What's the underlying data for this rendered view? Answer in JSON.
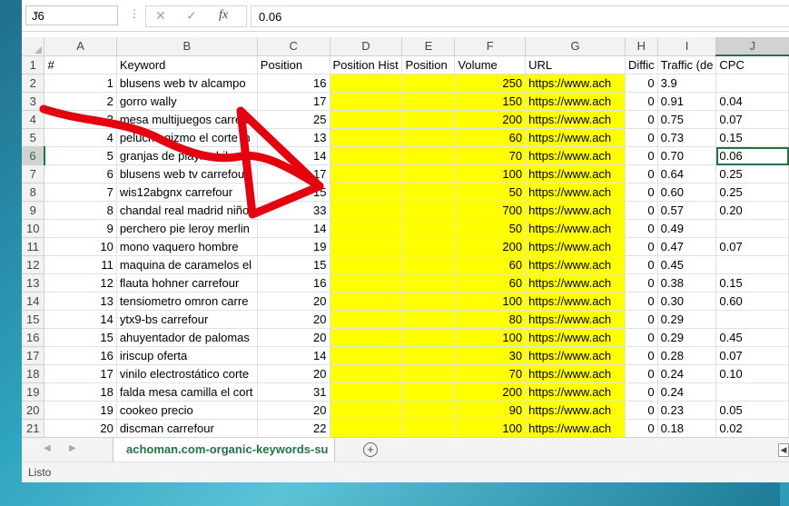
{
  "namebox": {
    "value": "J6"
  },
  "formula": {
    "cancel_icon": "✕",
    "enter_icon": "✓",
    "fx_label": "fx",
    "value": "0.06"
  },
  "columns": [
    "A",
    "B",
    "C",
    "D",
    "E",
    "F",
    "G",
    "H",
    "I",
    "J"
  ],
  "header_row": [
    "#",
    "Keyword",
    "Position",
    "Position Hist",
    "Position",
    "Volume",
    "URL",
    "Diffic",
    "Traffic (de",
    "CPC"
  ],
  "rows": [
    [
      "1",
      "blusens web tv alcampo",
      "16",
      "",
      "",
      "250",
      "https://www.ach",
      "0",
      "3.9",
      ""
    ],
    [
      "2",
      "gorro wally",
      "17",
      "",
      "",
      "150",
      "https://www.ach",
      "0",
      "0.91",
      "0.04"
    ],
    [
      "3",
      "mesa multijuegos carrefo",
      "25",
      "",
      "",
      "200",
      "https://www.ach",
      "0",
      "0.75",
      "0.07"
    ],
    [
      "4",
      "peluche gizmo el corte in",
      "13",
      "",
      "",
      "60",
      "https://www.ach",
      "0",
      "0.73",
      "0.15"
    ],
    [
      "5",
      "granjas de playmobil",
      "14",
      "",
      "",
      "70",
      "https://www.ach",
      "0",
      "0.70",
      "0.06"
    ],
    [
      "6",
      "blusens web tv carrefour",
      "17",
      "",
      "",
      "100",
      "https://www.ach",
      "0",
      "0.64",
      "0.25"
    ],
    [
      "7",
      "wis12abgnx carrefour",
      "15",
      "",
      "",
      "50",
      "https://www.ach",
      "0",
      "0.60",
      "0.25"
    ],
    [
      "8",
      "chandal real madrid niño",
      "33",
      "",
      "",
      "700",
      "https://www.ach",
      "0",
      "0.57",
      "0.20"
    ],
    [
      "9",
      "perchero pie leroy merlin",
      "14",
      "",
      "",
      "50",
      "https://www.ach",
      "0",
      "0.49",
      ""
    ],
    [
      "10",
      "mono vaquero hombre",
      "19",
      "",
      "",
      "200",
      "https://www.ach",
      "0",
      "0.47",
      "0.07"
    ],
    [
      "11",
      "maquina de caramelos el",
      "15",
      "",
      "",
      "60",
      "https://www.ach",
      "0",
      "0.45",
      ""
    ],
    [
      "12",
      "flauta hohner carrefour",
      "16",
      "",
      "",
      "60",
      "https://www.ach",
      "0",
      "0.38",
      "0.15"
    ],
    [
      "13",
      "tensiometro omron carre",
      "20",
      "",
      "",
      "100",
      "https://www.ach",
      "0",
      "0.30",
      "0.60"
    ],
    [
      "14",
      "ytx9-bs carrefour",
      "20",
      "",
      "",
      "80",
      "https://www.ach",
      "0",
      "0.29",
      ""
    ],
    [
      "15",
      "ahuyentador de palomas",
      "20",
      "",
      "",
      "100",
      "https://www.ach",
      "0",
      "0.29",
      "0.45"
    ],
    [
      "16",
      "iriscup oferta",
      "14",
      "",
      "",
      "30",
      "https://www.ach",
      "0",
      "0.28",
      "0.07"
    ],
    [
      "17",
      "vinilo electrostático corte",
      "20",
      "",
      "",
      "70",
      "https://www.ach",
      "0",
      "0.24",
      "0.10"
    ],
    [
      "18",
      "falda mesa camilla el cort",
      "31",
      "",
      "",
      "200",
      "https://www.ach",
      "0",
      "0.24",
      ""
    ],
    [
      "19",
      "cookeo precio",
      "20",
      "",
      "",
      "90",
      "https://www.ach",
      "0",
      "0.23",
      "0.05"
    ],
    [
      "20",
      "discman carrefour",
      "22",
      "",
      "",
      "100",
      "https://www.ach",
      "0",
      "0.18",
      "0.02"
    ]
  ],
  "sheet_tab": {
    "label": "achoman.com-organic-keywords-su",
    "add_icon": "+"
  },
  "status": {
    "label": "Listo"
  },
  "colors": {
    "highlight": "#ffff00",
    "excel_green": "#217346",
    "annotation": "#e3000f"
  }
}
